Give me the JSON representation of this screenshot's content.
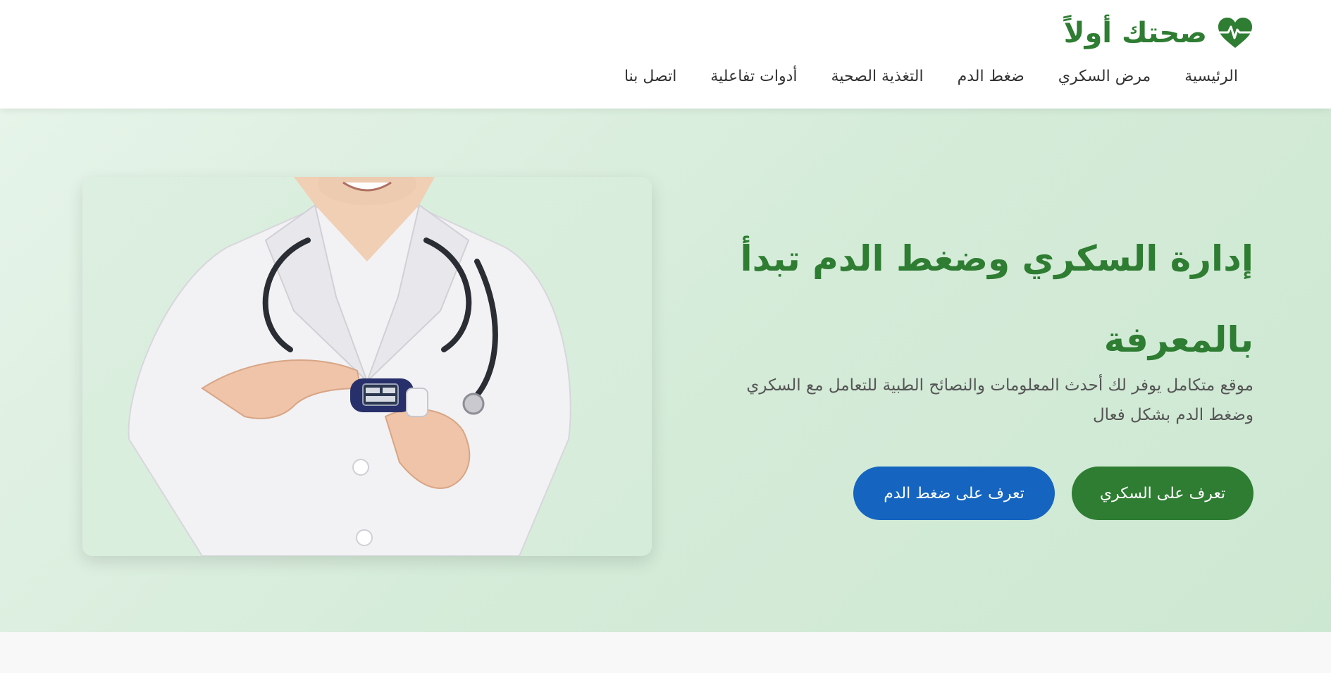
{
  "site": {
    "logo_text": "صحتك أولاً",
    "logo_icon": "heart-pulse-icon",
    "brand_color": "#2e7d32",
    "secondary_color": "#1565c0"
  },
  "nav": {
    "items": [
      {
        "label": "الرئيسية"
      },
      {
        "label": "مرض السكري"
      },
      {
        "label": "ضغط الدم"
      },
      {
        "label": "التغذية الصحية"
      },
      {
        "label": "أدوات تفاعلية"
      },
      {
        "label": "اتصل بنا"
      }
    ]
  },
  "hero": {
    "title": "إدارة السكري وضغط الدم تبدأ بالمعرفة",
    "subtitle": "موقع متكامل يوفر لك أحدث المعلومات والنصائح الطبية للتعامل مع السكري وضغط الدم بشكل فعال",
    "primary_button": "تعرف على السكري",
    "secondary_button": "تعرف على ضغط الدم"
  }
}
